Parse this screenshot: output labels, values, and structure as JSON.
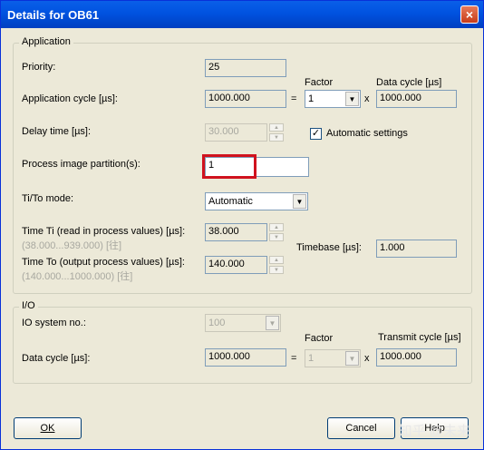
{
  "window": {
    "title": "Details for OB61",
    "close_glyph": "×"
  },
  "application": {
    "group_label": "Application",
    "priority": {
      "label": "Priority:",
      "value": "25"
    },
    "app_cycle": {
      "label": "Application cycle [µs]:",
      "value": "1000.000",
      "factor_label": "Factor",
      "factor_value": "1",
      "data_cycle_label": "Data cycle [µs]",
      "data_cycle_value": "1000.000",
      "eq": "=",
      "mul": "x"
    },
    "delay": {
      "label": "Delay time  [µs]:",
      "value": "30.000"
    },
    "auto_settings": {
      "label": "Automatic settings",
      "checked": true,
      "mark": "✓"
    },
    "pip": {
      "label": "Process image partition(s):",
      "value": "1"
    },
    "tito": {
      "label": "Ti/To mode:",
      "value": "Automatic"
    },
    "ti": {
      "label": "Time Ti (read in process values) [µs]:",
      "range": "(38.000...939.000) [往]",
      "value": "38.000"
    },
    "to": {
      "label": "Time To (output process values) [µs]:",
      "range": "(140.000...1000.000) [往]",
      "value": "140.000"
    },
    "timebase": {
      "label": "Timebase [µs]:",
      "value": "1.000"
    }
  },
  "io": {
    "group_label": "I/O",
    "io_system": {
      "label": "IO system no.:",
      "value": "100"
    },
    "data_cycle": {
      "label": "Data cycle [µs]:",
      "value": "1000.000",
      "factor_label": "Factor",
      "factor_value": "1",
      "transmit_label": "Transmit cycle [µs]",
      "transmit_value": "1000.000",
      "eq": "=",
      "mul": "x"
    }
  },
  "buttons": {
    "ok": "OK",
    "cancel": "Cancel",
    "help": "Help"
  },
  "watermark": "知乎 @未来"
}
